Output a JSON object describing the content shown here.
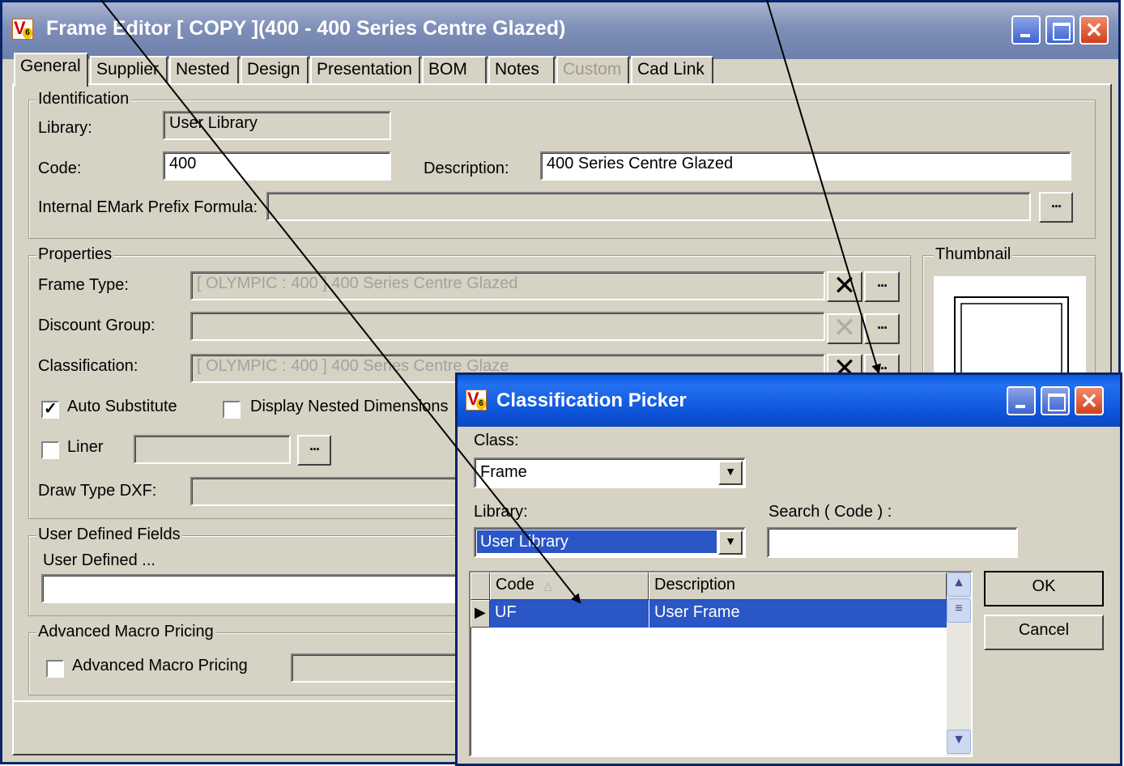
{
  "frame_editor": {
    "title": "Frame Editor  [ COPY ](400 - 400 Series Centre Glazed)",
    "tabs": [
      "General",
      "Supplier",
      "Nested",
      "Design",
      "Presentation",
      "BOM",
      "Notes",
      "Custom",
      "Cad Link"
    ],
    "active_tab": "General",
    "identification": {
      "legend": "Identification",
      "library_label": "Library:",
      "library_value": "User Library",
      "code_label": "Code:",
      "code_value": "400",
      "description_label": "Description:",
      "description_value": "400 Series Centre Glazed",
      "emark_label": "Internal EMark Prefix Formula:",
      "emark_value": ""
    },
    "properties": {
      "legend": "Properties",
      "frame_type_label": "Frame Type:",
      "frame_type_value": "[ OLYMPIC : 400 ]   400 Series Centre Glazed",
      "discount_group_label": "Discount Group:",
      "discount_group_value": "",
      "classification_label": "Classification:",
      "classification_value": "[ OLYMPIC : 400 ]   400 Series Centre Glaze",
      "auto_substitute_label": "Auto Substitute",
      "auto_substitute_checked": true,
      "display_nested_label": "Display Nested Dimensions",
      "display_nested_checked": false,
      "liner_label": "Liner",
      "liner_checked": false,
      "liner_value": "",
      "draw_type_label": "Draw Type DXF:",
      "draw_type_value": ""
    },
    "thumbnail_legend": "Thumbnail",
    "user_defined": {
      "legend": "User Defined Fields",
      "field_label": "User Defined ...",
      "field_value": ""
    },
    "advanced": {
      "legend": "Advanced Macro Pricing",
      "checkbox_label": "Advanced Macro Pricing",
      "checked": false
    },
    "ellipsis": "...",
    "clear_glyph": "✕"
  },
  "picker": {
    "title": "Classification Picker",
    "class_label": "Class:",
    "class_value": "Frame",
    "library_label": "Library:",
    "library_value": "User Library",
    "search_label": "Search ( Code ) :",
    "search_value": "",
    "columns": [
      "Code",
      "Description"
    ],
    "rows": [
      {
        "code": "UF",
        "description": "User Frame"
      }
    ],
    "ok_label": "OK",
    "cancel_label": "Cancel"
  },
  "colors": {
    "title_inactive": "#7e8fb8",
    "title_active": "#0a5ae0",
    "selection": "#2a56c6",
    "window_face": "#d6d2c4"
  }
}
